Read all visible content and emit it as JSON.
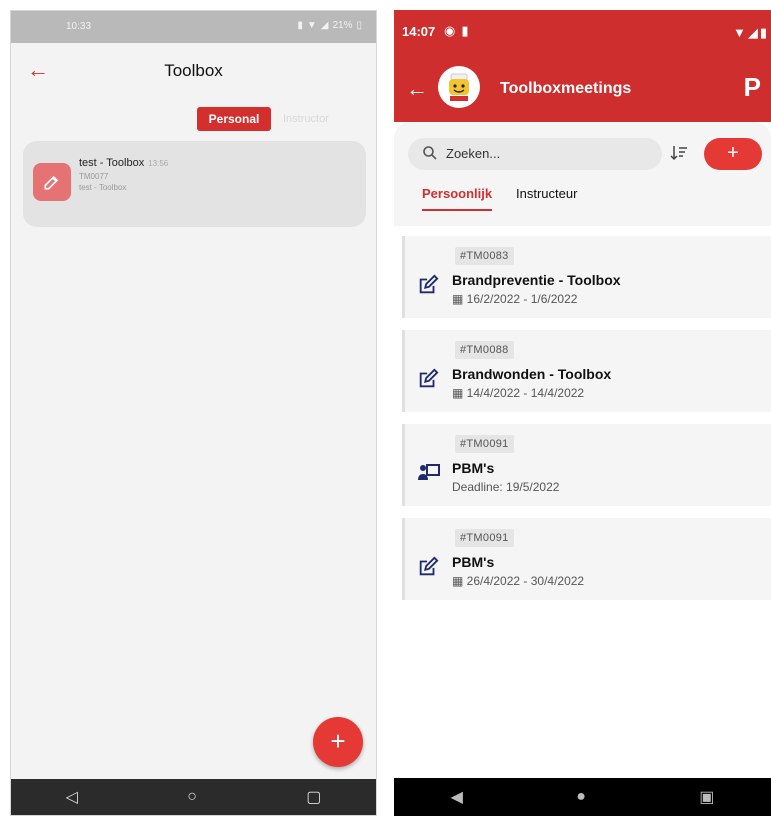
{
  "left": {
    "status_time": "10:33",
    "status_battery": "21%",
    "title": "Toolbox",
    "tabs": {
      "personal": "Personal",
      "instructor": "Instructor"
    },
    "card": {
      "title": "test - Toolbox",
      "time": "13:56",
      "code": "TM0077",
      "subtitle": "test - Toolbox"
    },
    "fab": "+"
  },
  "right": {
    "status_time": "14:07",
    "title": "Toolboxmeetings",
    "logo": "P",
    "search_placeholder": "Zoeken...",
    "add_label": "+",
    "tabs": {
      "personal": "Persoonlijk",
      "instructor": "Instructeur"
    },
    "items": [
      {
        "tag": "#TM0083",
        "title": "Brandpreventie - Toolbox",
        "detail": "16/2/2022 - 1/6/2022",
        "icon": "edit-icon",
        "detail_icon": "calendar-icon"
      },
      {
        "tag": "#TM0088",
        "title": "Brandwonden - Toolbox",
        "detail": "14/4/2022 - 14/4/2022",
        "icon": "edit-icon",
        "detail_icon": "calendar-icon"
      },
      {
        "tag": "#TM0091",
        "title": "PBM's",
        "detail": "Deadline: 19/5/2022",
        "icon": "presentation-icon",
        "detail_icon": ""
      },
      {
        "tag": "#TM0091",
        "title": "PBM's",
        "detail": "26/4/2022 - 30/4/2022",
        "icon": "edit-icon",
        "detail_icon": "calendar-icon"
      }
    ]
  },
  "colors": {
    "brand_red": "#cf2e2e",
    "accent_red": "#e53935",
    "edit_icon_blue": "#1e2a6b"
  }
}
